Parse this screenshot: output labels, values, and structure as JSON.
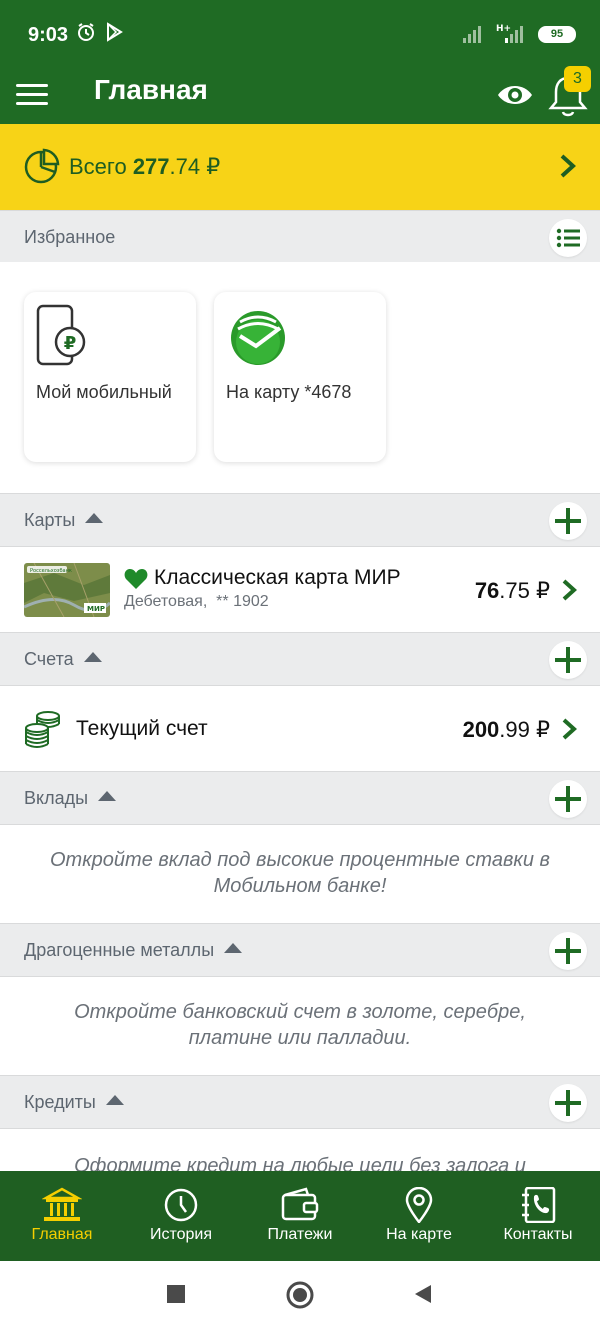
{
  "status": {
    "time": "9:03",
    "battery": "95"
  },
  "header": {
    "title": "Главная",
    "notifications_count": "3"
  },
  "summary": {
    "label": "Всего",
    "amount_int": "277",
    "amount_frac": ".74 ₽"
  },
  "favorites": {
    "title": "Избранное",
    "items": [
      {
        "label": "Мой мобильный"
      },
      {
        "label": "На карту *4678"
      }
    ]
  },
  "cards": {
    "title": "Карты",
    "items": [
      {
        "name": "Классическая карта МИР",
        "type": "Дебетовая,",
        "number": "** 1902",
        "amount_int": "76",
        "amount_frac": ".75 ₽",
        "thumb_bank": "Россельхозбанк",
        "thumb_brand": "МИР"
      }
    ]
  },
  "accounts": {
    "title": "Счета",
    "items": [
      {
        "name": "Текущий счет",
        "amount_int": "200",
        "amount_frac": ".99 ₽"
      }
    ]
  },
  "deposits": {
    "title": "Вклады",
    "promo": "Откройте вклад под высокие процентные ставки в Мобильном банке!"
  },
  "metals": {
    "title": "Драгоценные металлы",
    "promo": "Откройте банковский счет в золоте, серебре, платине или палладии."
  },
  "credits": {
    "title": "Кредиты",
    "promo": "Оформите кредит на любые цели без залога и"
  },
  "nav": {
    "items": [
      {
        "label": "Главная",
        "icon": "bank-icon"
      },
      {
        "label": "История",
        "icon": "clock-icon"
      },
      {
        "label": "Платежи",
        "icon": "wallet-icon"
      },
      {
        "label": "На карте",
        "icon": "map-pin-icon"
      },
      {
        "label": "Контакты",
        "icon": "contacts-book-icon"
      }
    ]
  },
  "colors": {
    "primary": "#1f6b24",
    "accent": "#f7d317",
    "nav_bg": "#1f5f22",
    "active_nav": "#f5cf00"
  }
}
